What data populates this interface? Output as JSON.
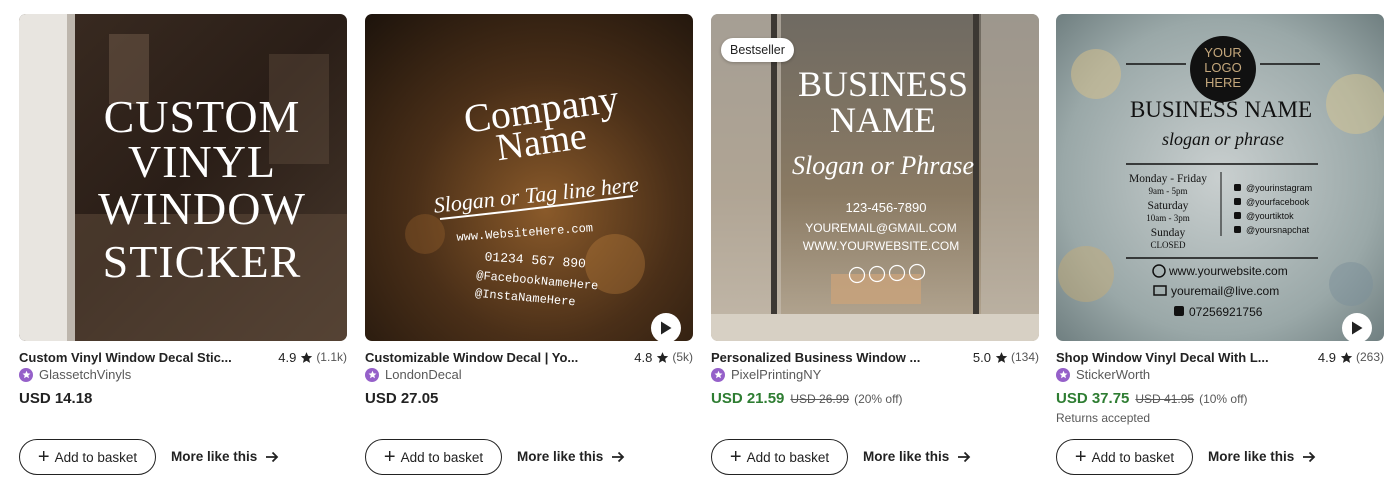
{
  "cards": [
    {
      "title": "Custom Vinyl Window Decal Stic...",
      "rating": "4.9",
      "reviews": "(1.1k)",
      "shop": "GlassetchVinyls",
      "price": "USD 14.18",
      "add_label": "Add to basket",
      "more_label": "More like this",
      "image_text": [
        "CUSTOM",
        "VINYL",
        "WINDOW",
        "STICKER"
      ]
    },
    {
      "title": "Customizable Window Decal | Yo...",
      "rating": "4.8",
      "reviews": "(5k)",
      "shop": "LondonDecal",
      "price": "USD 27.05",
      "add_label": "Add to basket",
      "more_label": "More like this",
      "image_text": [
        "Company",
        "Name",
        "Slogan or Tag line here",
        "www.WebsiteHere.com",
        "01234 567 890",
        "@FacebookNameHere",
        "@InstaNameHere"
      ]
    },
    {
      "badge": "Bestseller",
      "title": "Personalized Business Window ...",
      "rating": "5.0",
      "reviews": "(134)",
      "shop": "PixelPrintingNY",
      "price": "USD 21.59",
      "original_price": "USD 26.99",
      "discount": "(20% off)",
      "add_label": "Add to basket",
      "more_label": "More like this",
      "image_text": [
        "BUSINESS",
        "NAME",
        "Slogan or Phrase",
        "123-456-7890",
        "YOUREMAIL@GMAIL.COM",
        "WWW.YOURWEBSITE.COM"
      ]
    },
    {
      "title": "Shop Window Vinyl Decal With L...",
      "rating": "4.9",
      "reviews": "(263)",
      "shop": "StickerWorth",
      "price": "USD 37.75",
      "original_price": "USD 41.95",
      "discount": "(10% off)",
      "returns": "Returns accepted",
      "add_label": "Add to basket",
      "more_label": "More like this",
      "image_text": [
        "YOUR",
        "LOGO",
        "HERE",
        "BUSINESS NAME",
        "slogan or phrase",
        "Monday - Friday",
        "9am - 5pm",
        "Saturday",
        "10am - 3pm",
        "Sunday",
        "CLOSED",
        "@yourinstagram",
        "@yourfacebook",
        "@yourtiktok",
        "@yoursnapchat",
        "www.yourwebsite.com",
        "youremail@live.com",
        "07256921756"
      ]
    }
  ],
  "colors": {
    "sale": "#2e7d32",
    "star_seller": "#9560c9"
  }
}
